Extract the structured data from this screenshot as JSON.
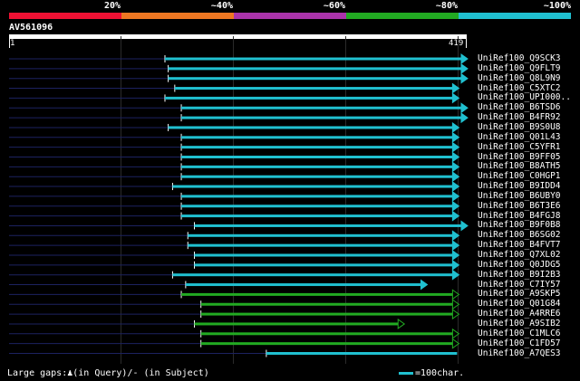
{
  "scale": {
    "labels": [
      "20%",
      "~40%",
      "~60%",
      "~80%",
      "~100%"
    ],
    "colors": [
      "#ee1133",
      "#ee7722",
      "#aa33aa",
      "#22aa22",
      "#20c0d0"
    ]
  },
  "query": {
    "id": "AV561096",
    "start": "1",
    "end": "419",
    "length": 419
  },
  "hits": [
    {
      "name": "UniRef100_Q9SCK3",
      "start": 143,
      "end": 419,
      "color": "#20c0d0",
      "arrow": "closed"
    },
    {
      "name": "UniRef100_Q9FLT9",
      "start": 146,
      "end": 419,
      "color": "#20c0d0",
      "arrow": "closed"
    },
    {
      "name": "UniRef100_Q8L9N9",
      "start": 146,
      "end": 419,
      "color": "#20c0d0",
      "arrow": "closed"
    },
    {
      "name": "UniRef100_C5XTC2",
      "start": 152,
      "end": 411,
      "color": "#20c0d0",
      "arrow": "closed"
    },
    {
      "name": "UniRef100_UPI000..",
      "start": 143,
      "end": 411,
      "color": "#20c0d0",
      "arrow": "closed"
    },
    {
      "name": "UniRef100_B6TSD6",
      "start": 158,
      "end": 419,
      "color": "#20c0d0",
      "arrow": "closed"
    },
    {
      "name": "UniRef100_B4FR92",
      "start": 158,
      "end": 419,
      "color": "#20c0d0",
      "arrow": "closed"
    },
    {
      "name": "UniRef100_B9S0U8",
      "start": 146,
      "end": 411,
      "color": "#20c0d0",
      "arrow": "closed"
    },
    {
      "name": "UniRef100_Q01L43",
      "start": 158,
      "end": 411,
      "color": "#20c0d0",
      "arrow": "closed"
    },
    {
      "name": "UniRef100_C5YFR1",
      "start": 158,
      "end": 411,
      "color": "#20c0d0",
      "arrow": "closed"
    },
    {
      "name": "UniRef100_B9FF05",
      "start": 158,
      "end": 411,
      "color": "#20c0d0",
      "arrow": "closed"
    },
    {
      "name": "UniRef100_B8ATH5",
      "start": 158,
      "end": 411,
      "color": "#20c0d0",
      "arrow": "closed"
    },
    {
      "name": "UniRef100_C0HGP1",
      "start": 158,
      "end": 411,
      "color": "#20c0d0",
      "arrow": "closed"
    },
    {
      "name": "UniRef100_B9IDD4",
      "start": 150,
      "end": 411,
      "color": "#20c0d0",
      "arrow": "closed"
    },
    {
      "name": "UniRef100_B6UBY0",
      "start": 158,
      "end": 411,
      "color": "#20c0d0",
      "arrow": "closed"
    },
    {
      "name": "UniRef100_B6T3E6",
      "start": 158,
      "end": 411,
      "color": "#20c0d0",
      "arrow": "closed"
    },
    {
      "name": "UniRef100_B4FGJ8",
      "start": 158,
      "end": 411,
      "color": "#20c0d0",
      "arrow": "closed"
    },
    {
      "name": "UniRef100_B9F0B8",
      "start": 170,
      "end": 419,
      "color": "#20c0d0",
      "arrow": "closed"
    },
    {
      "name": "UniRef100_B6SG02",
      "start": 164,
      "end": 411,
      "color": "#20c0d0",
      "arrow": "closed"
    },
    {
      "name": "UniRef100_B4FVT7",
      "start": 164,
      "end": 411,
      "color": "#20c0d0",
      "arrow": "closed"
    },
    {
      "name": "UniRef100_Q7XL02",
      "start": 170,
      "end": 411,
      "color": "#20c0d0",
      "arrow": "closed"
    },
    {
      "name": "UniRef100_Q0JDG5",
      "start": 170,
      "end": 411,
      "color": "#20c0d0",
      "arrow": "closed"
    },
    {
      "name": "UniRef100_B9I2B3",
      "start": 150,
      "end": 411,
      "color": "#20c0d0",
      "arrow": "closed"
    },
    {
      "name": "UniRef100_C7IY57",
      "start": 162,
      "end": 382,
      "color": "#20c0d0",
      "arrow": "closed"
    },
    {
      "name": "UniRef100_A9SKP5",
      "start": 158,
      "end": 411,
      "color": "#22aa22",
      "arrow": "open"
    },
    {
      "name": "UniRef100_Q01G84",
      "start": 176,
      "end": 411,
      "color": "#22aa22",
      "arrow": "open"
    },
    {
      "name": "UniRef100_A4RRE6",
      "start": 176,
      "end": 411,
      "color": "#22aa22",
      "arrow": "open"
    },
    {
      "name": "UniRef100_A9SIB2",
      "start": 170,
      "end": 361,
      "color": "#22aa22",
      "arrow": "open"
    },
    {
      "name": "UniRef100_C1MLC6",
      "start": 176,
      "end": 411,
      "color": "#22aa22",
      "arrow": "open"
    },
    {
      "name": "UniRef100_C1FD57",
      "start": 176,
      "end": 411,
      "color": "#22aa22",
      "arrow": "open"
    },
    {
      "name": "UniRef100_A7QES3",
      "start": 236,
      "end": 411,
      "color": "#20c0d0",
      "arrow": "none"
    }
  ],
  "footer": {
    "gaps_text": "Large gaps:♟(in Query)/- (in Subject)",
    "legend_text": "=100char."
  }
}
